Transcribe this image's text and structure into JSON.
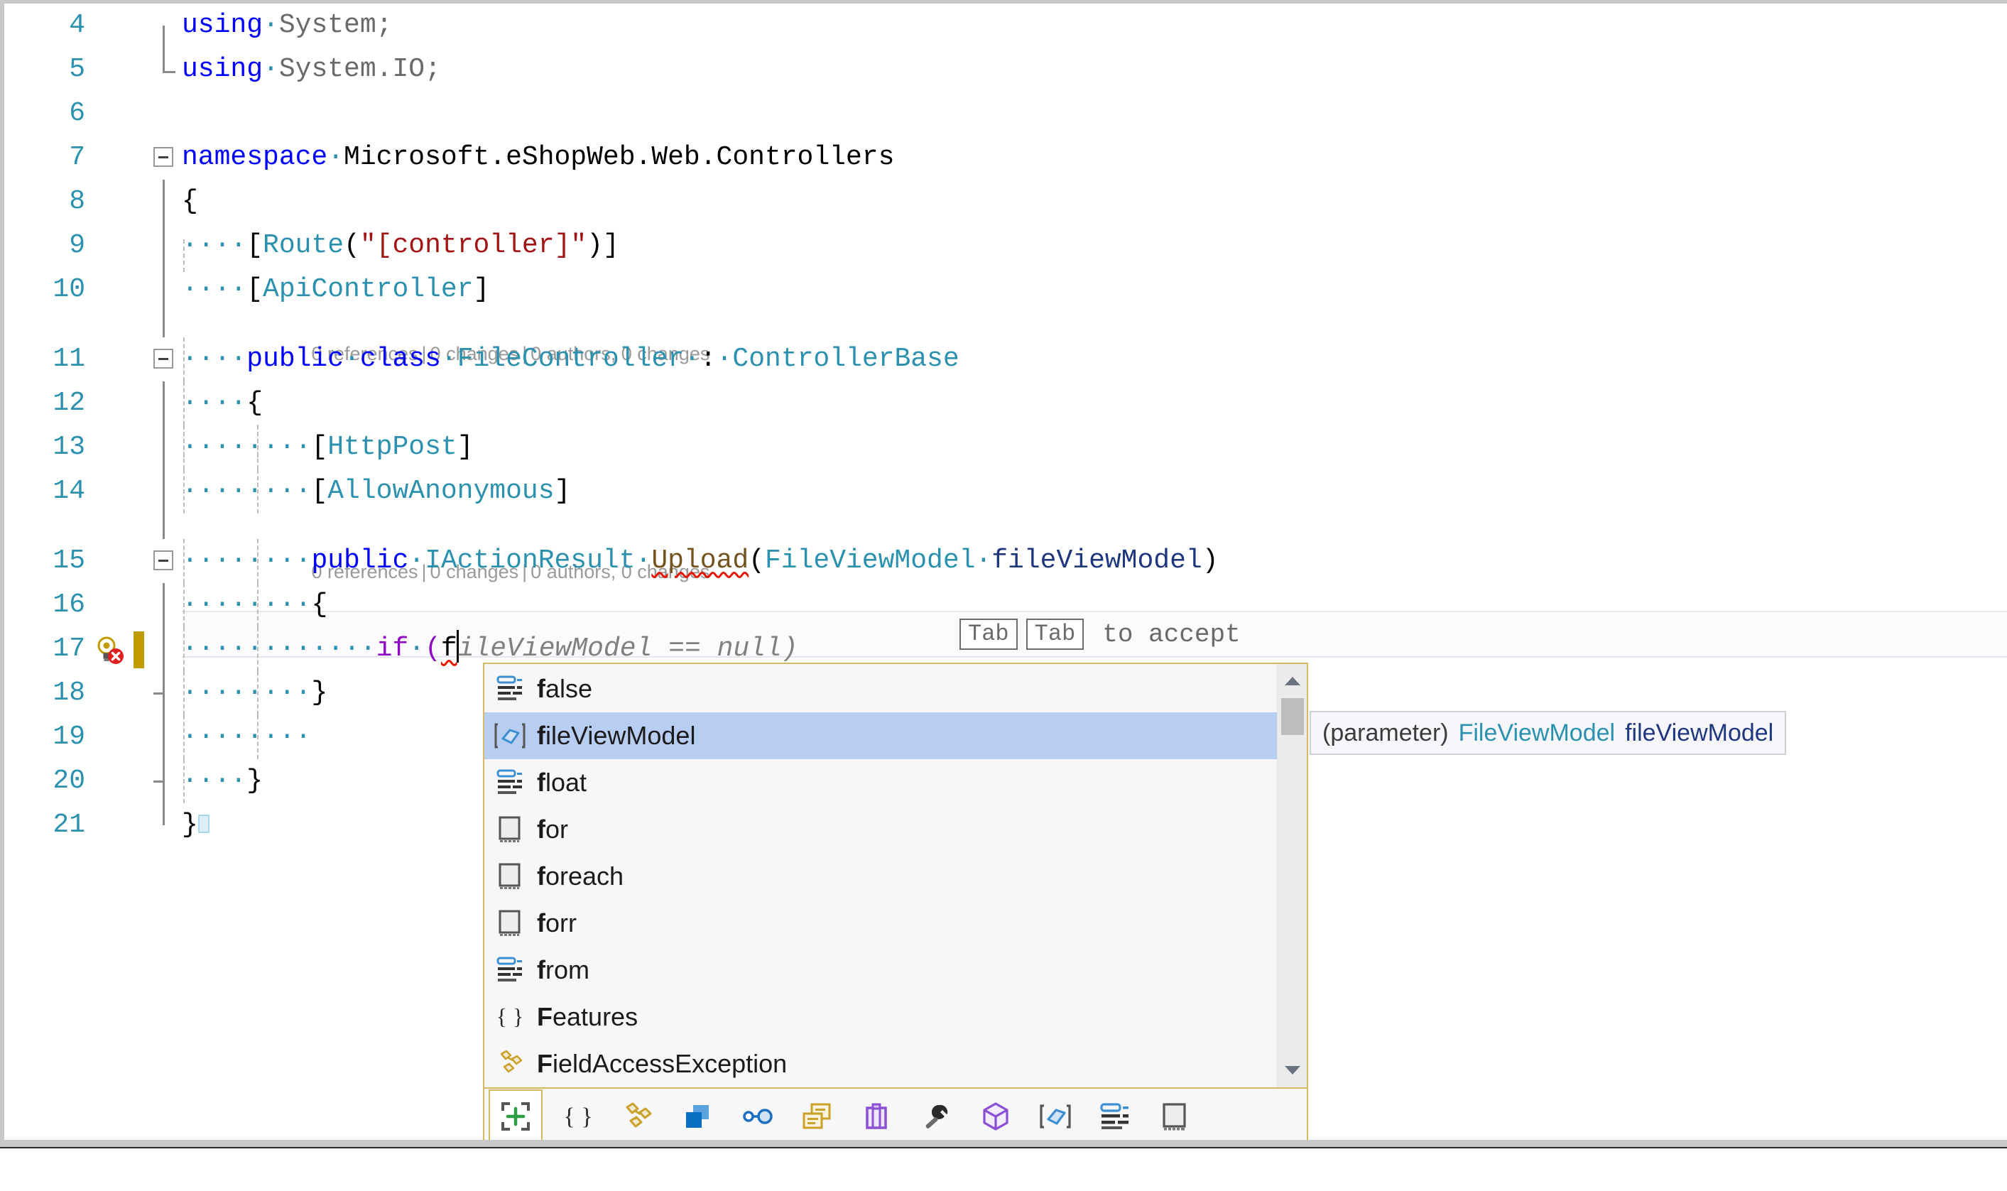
{
  "editor": {
    "language": "csharp",
    "first_line_number": 4,
    "current_line": 17,
    "lines": [
      {
        "num": "4",
        "indent_dots": "",
        "text": "using System;"
      },
      {
        "num": "5",
        "indent_dots": "",
        "text": "using System.IO;"
      },
      {
        "num": "6",
        "indent_dots": "",
        "text": ""
      },
      {
        "num": "7",
        "indent_dots": "",
        "text": "namespace Microsoft.eShopWeb.Web.Controllers"
      },
      {
        "num": "8",
        "indent_dots": "",
        "text": "{"
      },
      {
        "num": "9",
        "indent_dots": "····",
        "text": "[Route(\"[controller]\")]"
      },
      {
        "num": "10",
        "indent_dots": "····",
        "text": "[ApiController]"
      },
      {
        "num": "11",
        "indent_dots": "····",
        "text": "public class FileController : ControllerBase"
      },
      {
        "num": "12",
        "indent_dots": "····",
        "text": "{"
      },
      {
        "num": "13",
        "indent_dots": "········",
        "text": "[HttpPost]"
      },
      {
        "num": "14",
        "indent_dots": "········",
        "text": "[AllowAnonymous]"
      },
      {
        "num": "15",
        "indent_dots": "········",
        "text": "public IActionResult Upload(FileViewModel fileViewModel)"
      },
      {
        "num": "16",
        "indent_dots": "········",
        "text": "{"
      },
      {
        "num": "17",
        "indent_dots": "············",
        "text": "if (f"
      },
      {
        "num": "18",
        "indent_dots": "········",
        "text": "}"
      },
      {
        "num": "19",
        "indent_dots": "········",
        "text": ""
      },
      {
        "num": "20",
        "indent_dots": "····",
        "text": "}"
      },
      {
        "num": "21",
        "indent_dots": "",
        "text": "}"
      }
    ],
    "tokens": {
      "using_keyword": "using",
      "system": "System;",
      "system_io": "System.IO;",
      "namespace_keyword": "namespace",
      "namespace_name": "Microsoft.eShopWeb.Web.Controllers",
      "open_brace": "{",
      "close_brace": "}",
      "attr_route_open": "[",
      "attr_route_name": "Route",
      "attr_route_paren_open": "(",
      "attr_route_string": "\"[controller]\"",
      "attr_route_paren_close": ")",
      "attr_route_close": "]",
      "attr_apicontroller": "[ApiController]",
      "attr_httppost": "[HttpPost]",
      "attr_allowanonymous": "[AllowAnonymous]",
      "public_keyword": "public",
      "class_keyword": "class",
      "class_name": "FileController",
      "colon": ":",
      "base_class": "ControllerBase",
      "return_type": "IActionResult",
      "method_name": "Upload",
      "param_type": "FileViewModel",
      "param_name": "fileViewModel",
      "if_keyword": "if",
      "typed_prefix": "f",
      "ghost_suggestion": "ileViewModel == null)"
    },
    "codelens": {
      "line11": "0 references | 0 changes | 0 authors, 0 changes",
      "line15": "0 references | 0 changes | 0 authors, 0 changes",
      "references": "0 references",
      "changes": "0 changes",
      "authors": "0 authors, 0 changes",
      "separator": "|"
    },
    "gutter_icons": {
      "line17": "lightbulb-error-icon",
      "line17_change_bar": "pending-change-bar"
    }
  },
  "inline_suggestion_hint": {
    "key1": "Tab",
    "key2": "Tab",
    "text": "to accept"
  },
  "intellisense": {
    "selected_index": 1,
    "items": [
      {
        "label": "false",
        "match": "f",
        "rest": "alse",
        "icon": "keyword-icon"
      },
      {
        "label": "fileViewModel",
        "match": "f",
        "rest": "ileViewModel",
        "icon": "local-variable-icon"
      },
      {
        "label": "float",
        "match": "f",
        "rest": "loat",
        "icon": "keyword-icon"
      },
      {
        "label": "for",
        "match": "f",
        "rest": "or",
        "icon": "snippet-icon"
      },
      {
        "label": "foreach",
        "match": "f",
        "rest": "oreach",
        "icon": "snippet-icon"
      },
      {
        "label": "forr",
        "match": "f",
        "rest": "orr",
        "icon": "snippet-icon"
      },
      {
        "label": "from",
        "match": "f",
        "rest": "rom",
        "icon": "keyword-icon"
      },
      {
        "label": "Features",
        "match": "F",
        "rest": "eatures",
        "icon": "namespace-icon"
      },
      {
        "label": "FieldAccessException",
        "match": "F",
        "rest": "ieldAccessException",
        "icon": "class-icon"
      }
    ],
    "scrollbar": {
      "up_arrow": "scroll-up-arrow-icon",
      "down_arrow": "scroll-down-arrow-icon"
    },
    "filter_toolbar": [
      {
        "name": "expand-all-filter",
        "icon": "expand-plus-icon"
      },
      {
        "name": "namespaces-filter",
        "icon": "namespace-icon"
      },
      {
        "name": "classes-filter",
        "icon": "class-icon"
      },
      {
        "name": "structs-filter",
        "icon": "struct-icon"
      },
      {
        "name": "interfaces-filter",
        "icon": "interface-icon"
      },
      {
        "name": "enums-filter",
        "icon": "enum-icon"
      },
      {
        "name": "delegates-filter",
        "icon": "delegate-icon"
      },
      {
        "name": "methods-filter",
        "icon": "wrench-icon"
      },
      {
        "name": "modules-filter",
        "icon": "cube-icon"
      },
      {
        "name": "locals-filter",
        "icon": "local-variable-icon"
      },
      {
        "name": "keywords-filter",
        "icon": "keyword-icon"
      },
      {
        "name": "snippets-filter",
        "icon": "snippet-icon"
      }
    ]
  },
  "quickinfo": {
    "kind": "(parameter)",
    "type": "FileViewModel",
    "name": "fileViewModel"
  },
  "colors": {
    "keyword_blue": "#0000ff",
    "control_purple": "#8f08c4",
    "type_teal": "#2b91af",
    "identifier_navy": "#1f377f",
    "method_brown": "#74531f",
    "string_red": "#a31515",
    "ghost_gray": "#808080",
    "error_squiggle": "#e51400",
    "selection_blue": "#b8cdf2",
    "popup_border_gold": "#d8b860",
    "change_bar_gold": "#c19c00",
    "codelens_gray": "#9a9a9a"
  }
}
